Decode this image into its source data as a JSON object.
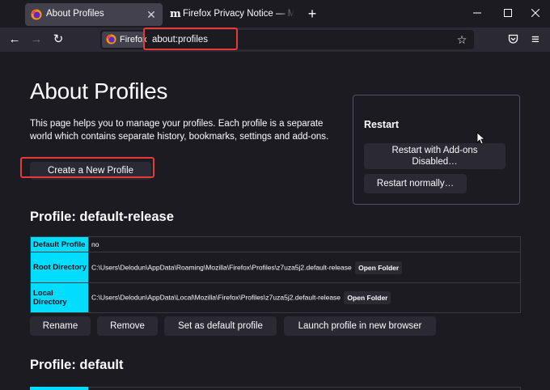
{
  "tabs": [
    {
      "title": "About Profiles",
      "active": true,
      "icon": "firefox-icon"
    },
    {
      "title": "Firefox Privacy Notice — Mozilla",
      "active": false,
      "icon": "mozilla-m-icon"
    }
  ],
  "tabstrip": {
    "new_tab": "+",
    "mozilla_mark": "m"
  },
  "window_controls": {
    "minimize": "—",
    "maximize": "☐",
    "close": "✕"
  },
  "navbar": {
    "back": "←",
    "forward": "→",
    "reload": "↻",
    "identity_label": "Firefox",
    "url": "about:profiles",
    "bookmark": "☆",
    "pocket": "pocket-icon",
    "menu": "≡"
  },
  "page": {
    "title": "About Profiles",
    "intro": "This page helps you to manage your profiles. Each profile is a separate world which contains separate history, bookmarks, settings and add-ons.",
    "create_button": "Create a New Profile",
    "restart": {
      "heading": "Restart",
      "addons_button_line1": "Restart with Add-ons",
      "addons_button_line2": "Disabled…",
      "normal_button": "Restart normally…"
    },
    "profiles": [
      {
        "title": "Profile: default-release",
        "rows": [
          {
            "label": "Default Profile",
            "value": "no"
          },
          {
            "label": "Root Directory",
            "value": "C:\\Users\\Delodun\\AppData\\Roaming\\Mozilla\\Firefox\\Profiles\\z7uza5j2.default-release",
            "button": "Open Folder"
          },
          {
            "label": "Local Directory",
            "value": "C:\\Users\\Delodun\\AppData\\Local\\Mozilla\\Firefox\\Profiles\\z7uza5j2.default-release",
            "button": "Open Folder"
          }
        ],
        "actions": [
          "Rename",
          "Remove",
          "Set as default profile",
          "Launch profile in new browser"
        ]
      },
      {
        "title": "Profile: default"
      }
    ]
  },
  "colors": {
    "accent_cyan": "#00ddff",
    "highlight_red": "#e63a3a",
    "page_bg": "#1c1b22",
    "button_bg": "#2b2a33"
  }
}
